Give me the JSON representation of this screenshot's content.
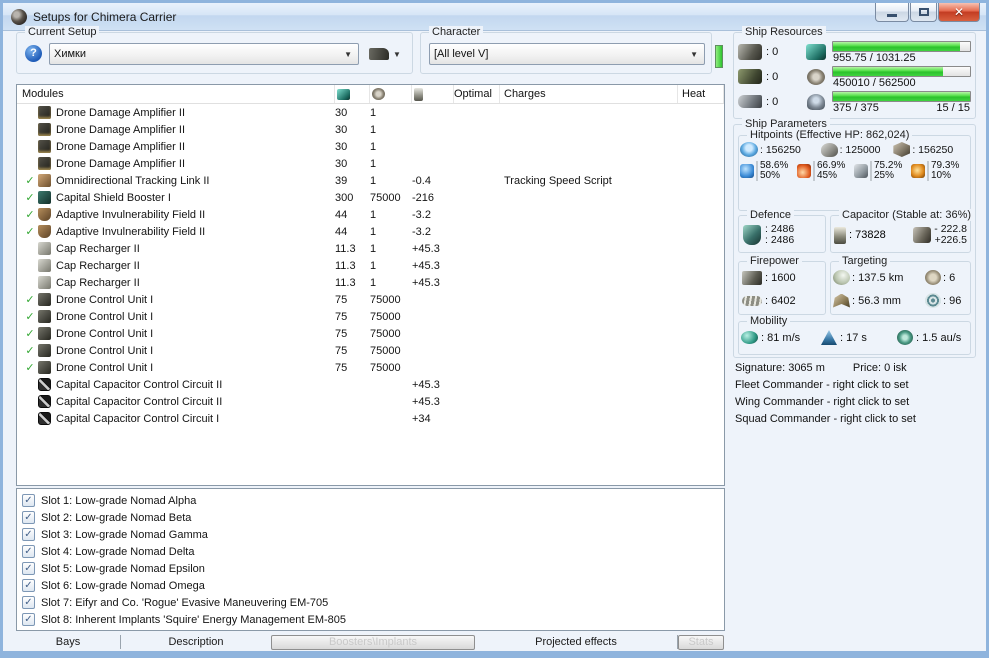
{
  "window": {
    "title": "Setups for Chimera Carrier"
  },
  "current_setup": {
    "label": "Current Setup",
    "value": "Химки",
    "help_icon": "help-icon",
    "ship_menu_icon": "ship-icon"
  },
  "character": {
    "label": "Character",
    "value": "[All level V]"
  },
  "ship_resources": {
    "label": "Ship Resources",
    "turrets": ": 0",
    "launchers": ": 0",
    "rigs": ": 0",
    "cpu": {
      "text": "955.75 / 1031.25",
      "pct": 93
    },
    "powergrid": {
      "text": "450010 / 562500",
      "pct": 80
    },
    "calibration": {
      "text": "375 / 375",
      "pct": 100
    },
    "drones": {
      "text": "15 / 15"
    }
  },
  "modules": {
    "header": {
      "name": "Modules",
      "optimal": "Optimal",
      "charges": "Charges",
      "heat": "Heat",
      "cpu_icon": "cpu-chip-icon",
      "pg_icon": "powergrid-icon",
      "cap_icon": "capacitor-icon"
    },
    "rows": [
      {
        "check": "",
        "icon": "drone-damage-amplifier-icon",
        "name": "Drone Damage Amplifier II",
        "cpu": "30",
        "pg": "1",
        "cap": "",
        "optimal": "",
        "charges": "",
        "heat": ""
      },
      {
        "check": "",
        "icon": "drone-damage-amplifier-icon",
        "name": "Drone Damage Amplifier II",
        "cpu": "30",
        "pg": "1",
        "cap": "",
        "optimal": "",
        "charges": "",
        "heat": ""
      },
      {
        "check": "",
        "icon": "drone-damage-amplifier-icon",
        "name": "Drone Damage Amplifier II",
        "cpu": "30",
        "pg": "1",
        "cap": "",
        "optimal": "",
        "charges": "",
        "heat": ""
      },
      {
        "check": "",
        "icon": "drone-damage-amplifier-icon",
        "name": "Drone Damage Amplifier II",
        "cpu": "30",
        "pg": "1",
        "cap": "",
        "optimal": "",
        "charges": "",
        "heat": ""
      },
      {
        "check": "✓",
        "icon": "tracking-link-icon",
        "name": "Omnidirectional Tracking Link II",
        "cpu": "39",
        "pg": "1",
        "cap": "-0.4",
        "optimal": "",
        "charges": "Tracking Speed Script",
        "heat": ""
      },
      {
        "check": "✓",
        "icon": "shield-booster-icon",
        "name": "Capital Shield Booster I",
        "cpu": "300",
        "pg": "75000",
        "cap": "-216",
        "optimal": "",
        "charges": "",
        "heat": ""
      },
      {
        "check": "✓",
        "icon": "invulnerability-field-icon",
        "name": "Adaptive Invulnerability Field II",
        "cpu": "44",
        "pg": "1",
        "cap": "-3.2",
        "optimal": "",
        "charges": "",
        "heat": ""
      },
      {
        "check": "✓",
        "icon": "invulnerability-field-icon",
        "name": "Adaptive Invulnerability Field II",
        "cpu": "44",
        "pg": "1",
        "cap": "-3.2",
        "optimal": "",
        "charges": "",
        "heat": ""
      },
      {
        "check": "",
        "icon": "cap-recharger-icon",
        "name": "Cap Recharger II",
        "cpu": "11.3",
        "pg": "1",
        "cap": "+45.3",
        "optimal": "",
        "charges": "",
        "heat": ""
      },
      {
        "check": "",
        "icon": "cap-recharger-icon",
        "name": "Cap Recharger II",
        "cpu": "11.3",
        "pg": "1",
        "cap": "+45.3",
        "optimal": "",
        "charges": "",
        "heat": ""
      },
      {
        "check": "",
        "icon": "cap-recharger-icon",
        "name": "Cap Recharger II",
        "cpu": "11.3",
        "pg": "1",
        "cap": "+45.3",
        "optimal": "",
        "charges": "",
        "heat": ""
      },
      {
        "check": "✓",
        "icon": "drone-control-unit-icon",
        "name": "Drone Control Unit I",
        "cpu": "75",
        "pg": "75000",
        "cap": "",
        "optimal": "",
        "charges": "",
        "heat": ""
      },
      {
        "check": "✓",
        "icon": "drone-control-unit-icon",
        "name": "Drone Control Unit I",
        "cpu": "75",
        "pg": "75000",
        "cap": "",
        "optimal": "",
        "charges": "",
        "heat": ""
      },
      {
        "check": "✓",
        "icon": "drone-control-unit-icon",
        "name": "Drone Control Unit I",
        "cpu": "75",
        "pg": "75000",
        "cap": "",
        "optimal": "",
        "charges": "",
        "heat": ""
      },
      {
        "check": "✓",
        "icon": "drone-control-unit-icon",
        "name": "Drone Control Unit I",
        "cpu": "75",
        "pg": "75000",
        "cap": "",
        "optimal": "",
        "charges": "",
        "heat": ""
      },
      {
        "check": "✓",
        "icon": "drone-control-unit-icon",
        "name": "Drone Control Unit I",
        "cpu": "75",
        "pg": "75000",
        "cap": "",
        "optimal": "",
        "charges": "",
        "heat": ""
      },
      {
        "check": "",
        "icon": "capacitor-rig-icon",
        "name": "Capital Capacitor Control Circuit II",
        "cpu": "",
        "pg": "",
        "cap": "+45.3",
        "optimal": "",
        "charges": "",
        "heat": ""
      },
      {
        "check": "",
        "icon": "capacitor-rig-icon",
        "name": "Capital Capacitor Control Circuit II",
        "cpu": "",
        "pg": "",
        "cap": "+45.3",
        "optimal": "",
        "charges": "",
        "heat": ""
      },
      {
        "check": "",
        "icon": "capacitor-rig-icon",
        "name": "Capital Capacitor Control Circuit I",
        "cpu": "",
        "pg": "",
        "cap": "+34",
        "optimal": "",
        "charges": "",
        "heat": ""
      }
    ]
  },
  "implants": {
    "check_glyph": "✓",
    "rows": [
      {
        "label": "Slot 1: Low-grade Nomad Alpha"
      },
      {
        "label": "Slot 2: Low-grade Nomad Beta"
      },
      {
        "label": "Slot 3: Low-grade Nomad Gamma"
      },
      {
        "label": "Slot 4: Low-grade Nomad Delta"
      },
      {
        "label": "Slot 5: Low-grade Nomad Epsilon"
      },
      {
        "label": "Slot 6: Low-grade Nomad Omega"
      },
      {
        "label": "Slot 7: Eifyr and Co. 'Rogue' Evasive Maneuvering EM-705"
      },
      {
        "label": "Slot 8: Inherent Implants 'Squire' Energy Management EM-805"
      }
    ]
  },
  "tabs": {
    "bays": "Bays",
    "description": "Description",
    "boosters": "Boosters\\Implants",
    "projected": "Projected effects",
    "stats": "Stats"
  },
  "ship_parameters": {
    "label": "Ship Parameters",
    "hitpoints": {
      "label": "Hitpoints (Effective HP: 862,024)",
      "shield": ": 156250",
      "armor": ": 125000",
      "structure": ": 156250",
      "resists": [
        {
          "icon": "em-resist-icon",
          "shield": "58.6%",
          "armor": "50%"
        },
        {
          "icon": "thermal-resist-icon",
          "shield": "66.9%",
          "armor": "45%"
        },
        {
          "icon": "kinetic-resist-icon",
          "shield": "75.2%",
          "armor": "25%"
        },
        {
          "icon": "explosive-resist-icon",
          "shield": "79.3%",
          "armor": "10%"
        }
      ]
    },
    "defence": {
      "label": "Defence",
      "value1": ": 2486",
      "value2": ": 2486"
    },
    "capacitor": {
      "label": "Capacitor (Stable at: 36%)",
      "amount": ": 73828",
      "peak_minus": "- 222.8",
      "peak_plus": "+226.5"
    },
    "firepower": {
      "label": "Firepower",
      "turret": ": 1600",
      "volley": ": 6402"
    },
    "targeting": {
      "label": "Targeting",
      "range": ": 137.5 km",
      "max_targets": ": 6",
      "scan_resolution": ": 56.3 mm",
      "sensor_strength": ": 96"
    },
    "mobility": {
      "label": "Mobility",
      "speed": ": 81 m/s",
      "align_time": ": 17 s",
      "warp_speed": ": 1.5 au/s"
    },
    "signature": "Signature: 3065 m",
    "price": "Price: 0 isk",
    "commanders": [
      "Fleet Commander - right click to set",
      "Wing Commander - right click to set",
      "Squad Commander - right click to set"
    ]
  }
}
